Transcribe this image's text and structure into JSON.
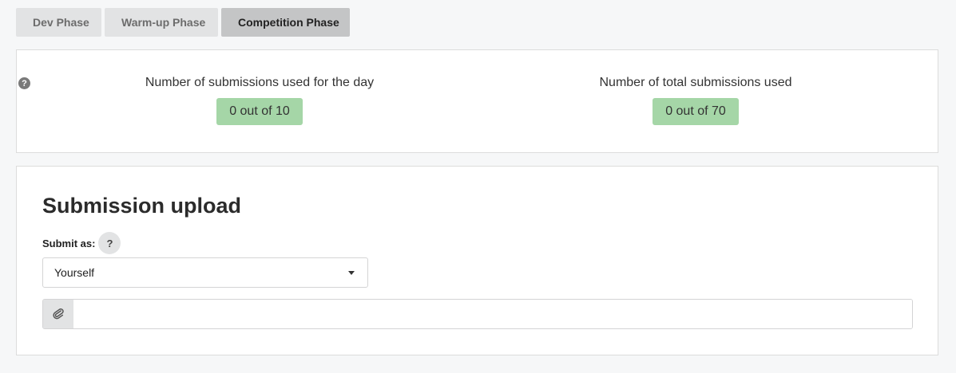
{
  "tabs": [
    {
      "label": "Dev Phase",
      "active": false
    },
    {
      "label": "Warm-up Phase",
      "active": false
    },
    {
      "label": "Competition Phase",
      "active": true
    }
  ],
  "stats": {
    "help_icon": "question-circle-icon",
    "daily": {
      "label": "Number of submissions used for the day",
      "value": "0 out of 10"
    },
    "total": {
      "label": "Number of total submissions used",
      "value": "0 out of 70"
    },
    "badge_color": "#a5d6a7"
  },
  "upload": {
    "title": "Submission upload",
    "submit_as_label": "Submit as:",
    "submit_as_help": "?",
    "submit_as_value": "Yourself",
    "dropdown_icon": "caret-down-icon",
    "file_icon": "paperclip-icon",
    "file_value": ""
  },
  "colors": {
    "page_bg": "#f6f7f8",
    "tab_bg": "#e2e3e4",
    "tab_active_bg": "#c4c5c6"
  }
}
